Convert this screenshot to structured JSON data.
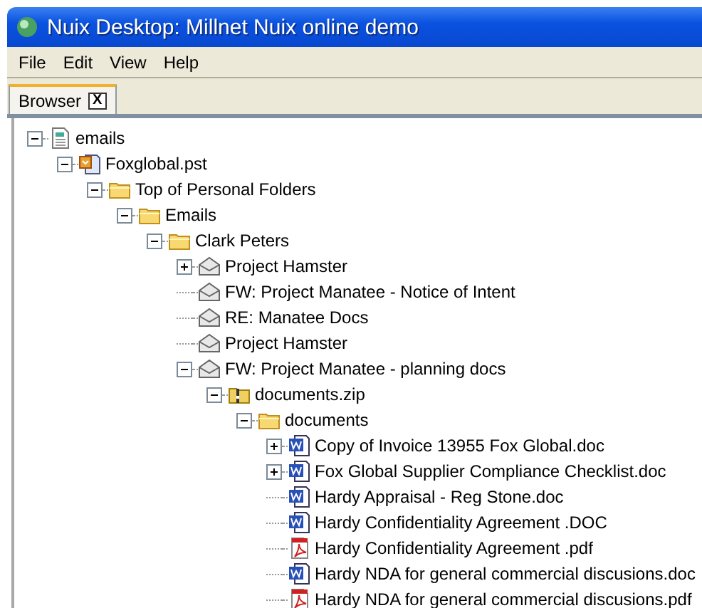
{
  "window": {
    "title": "Nuix Desktop: Millnet Nuix online demo"
  },
  "menu": [
    "File",
    "Edit",
    "View",
    "Help"
  ],
  "tabs": [
    {
      "label": "Browser",
      "selected": true,
      "close": "X"
    }
  ],
  "tree": [
    {
      "label": "emails",
      "kind": "file",
      "expanded": true,
      "children": [
        {
          "label": "Foxglobal.pst",
          "kind": "pst",
          "expanded": true,
          "children": [
            {
              "label": "Top of Personal Folders",
              "kind": "folder",
              "expanded": true,
              "children": [
                {
                  "label": "Emails",
                  "kind": "folder",
                  "expanded": true,
                  "children": [
                    {
                      "label": "Clark Peters",
                      "kind": "folder",
                      "expanded": true,
                      "children": [
                        {
                          "label": "Project Hamster",
                          "kind": "email",
                          "expanded": false
                        },
                        {
                          "label": "FW: Project Manatee - Notice of Intent",
                          "kind": "email"
                        },
                        {
                          "label": "RE: Manatee Docs",
                          "kind": "email"
                        },
                        {
                          "label": "Project Hamster",
                          "kind": "email"
                        },
                        {
                          "label": "FW: Project Manatee - planning docs",
                          "kind": "email",
                          "expanded": true,
                          "children": [
                            {
                              "label": "documents.zip",
                              "kind": "zip",
                              "expanded": true,
                              "children": [
                                {
                                  "label": "documents",
                                  "kind": "folder",
                                  "expanded": true,
                                  "children": [
                                    {
                                      "label": "Copy of Invoice 13955 Fox Global.doc",
                                      "kind": "word",
                                      "expanded": false
                                    },
                                    {
                                      "label": "Fox Global Supplier Compliance Checklist.doc",
                                      "kind": "word",
                                      "expanded": false
                                    },
                                    {
                                      "label": "Hardy Appraisal - Reg Stone.doc",
                                      "kind": "word"
                                    },
                                    {
                                      "label": "Hardy Confidentiality Agreement .DOC",
                                      "kind": "word"
                                    },
                                    {
                                      "label": "Hardy Confidentiality Agreement .pdf",
                                      "kind": "pdf"
                                    },
                                    {
                                      "label": "Hardy NDA for general commercial discusions.doc",
                                      "kind": "word"
                                    },
                                    {
                                      "label": "Hardy NDA for general commercial discusions.pdf",
                                      "kind": "pdf"
                                    }
                                  ]
                                }
                              ]
                            }
                          ]
                        }
                      ]
                    }
                  ]
                }
              ]
            }
          ]
        }
      ]
    }
  ]
}
